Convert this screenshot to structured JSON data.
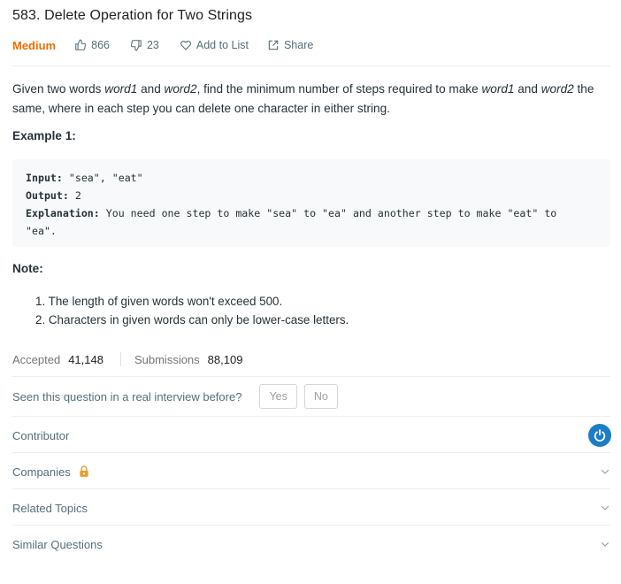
{
  "problem": {
    "title": "583. Delete Operation for Two Strings",
    "difficulty": "Medium",
    "likes": "866",
    "dislikes": "23",
    "add_to_list": "Add to List",
    "share": "Share"
  },
  "description": {
    "p1": "Given two words ",
    "w1": "word1",
    "p2": " and ",
    "w2": "word2",
    "p3": ", find the minimum number of steps required to make ",
    "w3": "word1",
    "p4": " and ",
    "w4": "word2",
    "p5": " the same, where in each step you can delete one character in either string."
  },
  "example": {
    "title": "Example 1:",
    "input_label": "Input:",
    "input_value": " \"sea\", \"eat\"",
    "output_label": "Output:",
    "output_value": " 2",
    "explanation_label": "Explanation:",
    "explanation_value": " You need one step to make \"sea\" to \"ea\" and another step to make \"eat\" to",
    "explanation_cont": "\"ea\"."
  },
  "note": {
    "title": "Note:",
    "items": [
      "1. The length of given words won't exceed 500.",
      "2. Characters in given words can only be lower-case letters."
    ]
  },
  "stats": {
    "accepted_label": "Accepted",
    "accepted_value": "41,148",
    "submissions_label": "Submissions",
    "submissions_value": "88,109"
  },
  "interview": {
    "question": "Seen this question in a real interview before?",
    "yes": "Yes",
    "no": "No"
  },
  "sections": {
    "contributor": "Contributor",
    "companies": "Companies",
    "related_topics": "Related Topics",
    "similar_questions": "Similar Questions"
  },
  "colors": {
    "difficulty": "#ef6c00",
    "lock": "#e0a030",
    "avatar": "#1b7ec2"
  },
  "icons": {
    "like": "thumbs-up-icon",
    "dislike": "thumbs-down-icon",
    "add_to_list": "heart-icon",
    "share": "share-icon",
    "lock": "lock-icon",
    "chevron": "chevron-down-icon",
    "avatar": "power-icon"
  }
}
